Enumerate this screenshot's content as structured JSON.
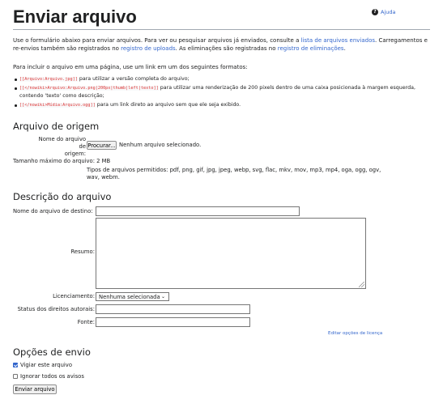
{
  "help": {
    "label": "Ajuda"
  },
  "title": "Enviar arquivo",
  "intro": {
    "t1": "Use o formulário abaixo para enviar arquivos. Para ver ou pesquisar arquivos já enviados, consulte a ",
    "link1": "lista de arquivos enviados",
    "t2": ". Carregamentos e re-envios também são registrados no ",
    "link2": "registro de uploads",
    "t3": ". As eliminações são registradas no ",
    "link3": "registro de eliminações",
    "t4": "."
  },
  "formats_intro": "Para incluir o arquivo em uma página, use um link em um dos seguintes formatos:",
  "formats": [
    {
      "code": "[[Arquivo:Arquivo.jpg]]",
      "text": " para utilizar a versão completa do arquivo;"
    },
    {
      "code": "[[</nowiki>Arquivo:Arquivo.png|200px|thumb|left|texto]]",
      "text": " para utilizar uma renderização de 200 pixels dentro de uma caixa posicionada à margem esquerda, contendo 'texto' como descrição;"
    },
    {
      "code": "[[</nowiki>Mídia:Arquivo.ogg]]",
      "text": " para um link direto ao arquivo sem que ele seja exibido."
    }
  ],
  "source": {
    "heading": "Arquivo de origem",
    "file_label_1": "Nome do arquivo de",
    "file_label_2": "origem:",
    "browse_button": "Procurar...",
    "no_file": "Nenhum arquivo selecionado.",
    "max_size": "Tamanho máximo do arquivo: 2 MB",
    "types_1": "Tipos de arquivos permitidos: pdf, png, gif, jpg, jpeg, webp, svg, flac, mkv, mov, mp3, mp4, oga, ogg, ogv,",
    "types_2": "wav, webm."
  },
  "description": {
    "heading": "Descrição do arquivo",
    "dest_label": "Nome do arquivo de destino:",
    "dest_value": "",
    "summary_label": "Resumo:",
    "summary_value": "",
    "license_label": "Licenciamento:",
    "license_value": "Nenhuma selecionada",
    "copyright_label": "Status dos direitos autorais:",
    "copyright_value": "",
    "source_label": "Fonte:",
    "source_value": "",
    "edit_license_link": "Editar opções de licença"
  },
  "options": {
    "heading": "Opções de envio",
    "watch_label": "Vigiar este arquivo",
    "watch_checked": true,
    "ignore_label": "Ignorar todos os avisos",
    "ignore_checked": false,
    "submit_button": "Enviar arquivo"
  },
  "colors": {
    "link": "#3366cc",
    "text": "#202122",
    "code": "#dd3333",
    "checkbox": "#3366cc"
  }
}
